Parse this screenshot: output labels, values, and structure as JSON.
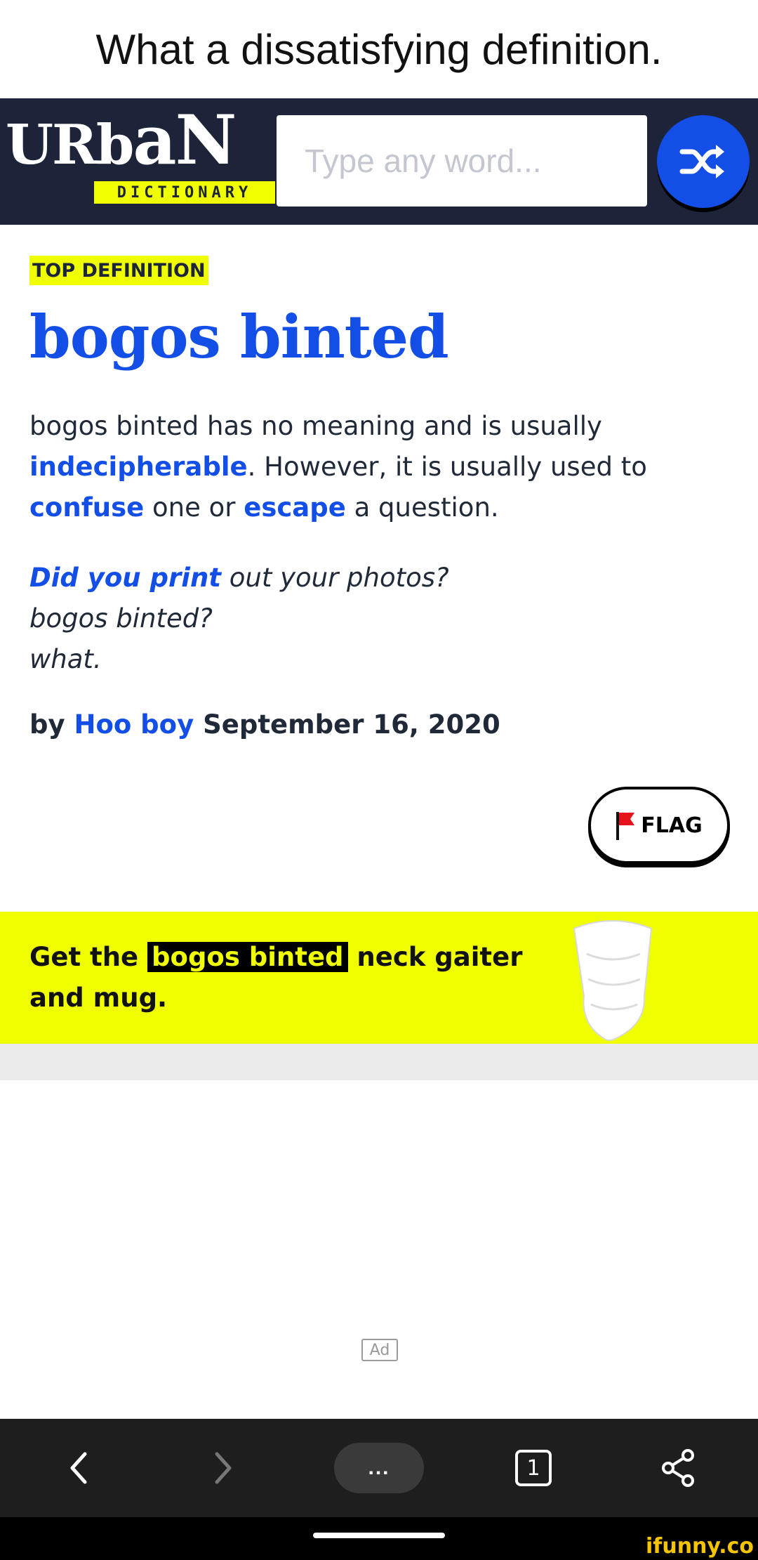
{
  "caption": "What a dissatisfying definition.",
  "header": {
    "logo_word_1": "URb",
    "logo_word_2": "aN",
    "logo_sub": "DICTIONARY",
    "search_placeholder": "Type any word..."
  },
  "definition": {
    "badge": "TOP DEFINITION",
    "word": "bogos binted",
    "meaning_1": "bogos binted has no meaning and is usually ",
    "meaning_link_1": "indecipherable",
    "meaning_2": ". However, it is usually used to ",
    "meaning_link_2": "confuse",
    "meaning_3": " one or ",
    "meaning_link_3": "escape",
    "meaning_4": " a question.",
    "example_link": "Did you print",
    "example_1": " out your photos?",
    "example_2": "bogos binted?",
    "example_3": "what.",
    "by": "by ",
    "author": "Hoo boy",
    "date": " September 16, 2020",
    "flag_label": "FLAG"
  },
  "promo": {
    "text_1": "Get the ",
    "highlight": "bogos binted",
    "text_2": " neck gaiter and mug."
  },
  "ad_label": "Ad",
  "browser_nav": {
    "menu_label": "...",
    "tab_count": "1"
  },
  "watermark": "ifunny.co",
  "colors": {
    "accent_blue": "#134fe6",
    "header_navy": "#1d2439",
    "highlight_yellow": "#efff00",
    "flag_red": "#e4131b"
  }
}
